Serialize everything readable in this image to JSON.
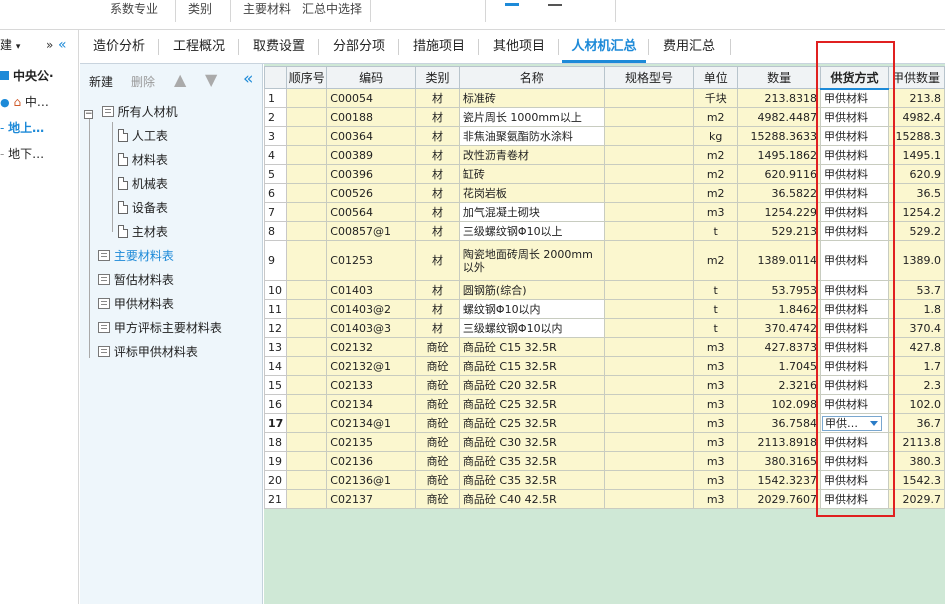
{
  "toolbar": {
    "items": [
      "系数专业",
      "类别",
      "主要材料",
      "汇总中选择"
    ]
  },
  "left_tree": {
    "new_label": "建",
    "collapse_label": "»",
    "nodes": [
      "中央公·",
      "中…",
      "地上…",
      "地下…"
    ]
  },
  "tabs": [
    "造价分析",
    "工程概况",
    "取费设置",
    "分部分项",
    "措施项目",
    "其他项目",
    "人材机汇总",
    "费用汇总"
  ],
  "active_tab": "人材机汇总",
  "category_panel": {
    "new_label": "新建",
    "delete_label": "删除",
    "root": "所有人材机",
    "children": [
      "人工表",
      "材料表",
      "机械表",
      "设备表",
      "主材表"
    ],
    "lists": [
      "主要材料表",
      "暂估材料表",
      "甲供材料表",
      "甲方评标主要材料表",
      "评标甲供材料表"
    ],
    "selected": "主要材料表"
  },
  "grid": {
    "columns": [
      "",
      "顺序号",
      "编码",
      "类别",
      "名称",
      "规格型号",
      "单位",
      "数量",
      "供货方式",
      "甲供数量"
    ],
    "rows": [
      {
        "no": "1",
        "code": "C00054",
        "type": "材",
        "name": "标准砖",
        "unit": "千块",
        "qty": "213.8318",
        "supply": "甲供材料",
        "jqty": "213.8"
      },
      {
        "no": "2",
        "code": "C00188",
        "type": "材",
        "name": "瓷片周长 1000mm以上",
        "unit": "m2",
        "qty": "4982.4487",
        "supply": "甲供材料",
        "jqty": "4982.4"
      },
      {
        "no": "3",
        "code": "C00364",
        "type": "材",
        "name": "非焦油聚氨酯防水涂料",
        "unit": "kg",
        "qty": "15288.3633",
        "supply": "甲供材料",
        "jqty": "15288.3"
      },
      {
        "no": "4",
        "code": "C00389",
        "type": "材",
        "name": "改性沥青卷材",
        "unit": "m2",
        "qty": "1495.1862",
        "supply": "甲供材料",
        "jqty": "1495.1"
      },
      {
        "no": "5",
        "code": "C00396",
        "type": "材",
        "name": "缸砖",
        "unit": "m2",
        "qty": "620.9116",
        "supply": "甲供材料",
        "jqty": "620.9"
      },
      {
        "no": "6",
        "code": "C00526",
        "type": "材",
        "name": "花岗岩板",
        "unit": "m2",
        "qty": "36.5822",
        "supply": "甲供材料",
        "jqty": "36.5"
      },
      {
        "no": "7",
        "code": "C00564",
        "type": "材",
        "name": "加气混凝土砌块",
        "unit": "m3",
        "qty": "1254.229",
        "supply": "甲供材料",
        "jqty": "1254.2"
      },
      {
        "no": "8",
        "code": "C00857@1",
        "type": "材",
        "name": "三级螺纹钢Φ10以上",
        "unit": "t",
        "qty": "529.213",
        "supply": "甲供材料",
        "jqty": "529.2"
      },
      {
        "no": "9",
        "code": "C01253",
        "type": "材",
        "name": "陶瓷地面砖周长 2000mm以外",
        "unit": "m2",
        "qty": "1389.0114",
        "supply": "甲供材料",
        "jqty": "1389.0"
      },
      {
        "no": "10",
        "code": "C01403",
        "type": "材",
        "name": "圆钢筋(综合)",
        "unit": "t",
        "qty": "53.7953",
        "supply": "甲供材料",
        "jqty": "53.7"
      },
      {
        "no": "11",
        "code": "C01403@2",
        "type": "材",
        "name": "螺纹钢Φ10以内",
        "unit": "t",
        "qty": "1.8462",
        "supply": "甲供材料",
        "jqty": "1.8"
      },
      {
        "no": "12",
        "code": "C01403@3",
        "type": "材",
        "name": "三级螺纹钢Φ10以内",
        "unit": "t",
        "qty": "370.4742",
        "supply": "甲供材料",
        "jqty": "370.4"
      },
      {
        "no": "13",
        "code": "C02132",
        "type": "商砼",
        "name": "商品砼 C15 32.5R",
        "unit": "m3",
        "qty": "427.8373",
        "supply": "甲供材料",
        "jqty": "427.8"
      },
      {
        "no": "14",
        "code": "C02132@1",
        "type": "商砼",
        "name": "商品砼 C15 32.5R",
        "unit": "m3",
        "qty": "1.7045",
        "supply": "甲供材料",
        "jqty": "1.7"
      },
      {
        "no": "15",
        "code": "C02133",
        "type": "商砼",
        "name": "商品砼 C20 32.5R",
        "unit": "m3",
        "qty": "2.3216",
        "supply": "甲供材料",
        "jqty": "2.3"
      },
      {
        "no": "16",
        "code": "C02134",
        "type": "商砼",
        "name": "商品砼 C25 32.5R",
        "unit": "m3",
        "qty": "102.098",
        "supply": "甲供材料",
        "jqty": "102.0"
      },
      {
        "no": "17",
        "code": "C02134@1",
        "type": "商砼",
        "name": "商品砼 C25 32.5R",
        "unit": "m3",
        "qty": "36.7584",
        "supply": "甲供…",
        "jqty": "36.7"
      },
      {
        "no": "18",
        "code": "C02135",
        "type": "商砼",
        "name": "商品砼 C30 32.5R",
        "unit": "m3",
        "qty": "2113.8918",
        "supply": "甲供材料",
        "jqty": "2113.8"
      },
      {
        "no": "19",
        "code": "C02136",
        "type": "商砼",
        "name": "商品砼 C35 32.5R",
        "unit": "m3",
        "qty": "380.3165",
        "supply": "甲供材料",
        "jqty": "380.3"
      },
      {
        "no": "20",
        "code": "C02136@1",
        "type": "商砼",
        "name": "商品砼 C35 32.5R",
        "unit": "m3",
        "qty": "1542.3237",
        "supply": "甲供材料",
        "jqty": "1542.3"
      },
      {
        "no": "21",
        "code": "C02137",
        "type": "商砼",
        "name": "商品砼 C40 42.5R",
        "unit": "m3",
        "qty": "2029.7607",
        "supply": "甲供材料",
        "jqty": "2029.7"
      }
    ]
  },
  "colors": {
    "accent": "#1d8ad8",
    "highlight": "#e02020",
    "cell_bg": "#fbf7cf",
    "empty_bg": "#cfe8d6"
  }
}
